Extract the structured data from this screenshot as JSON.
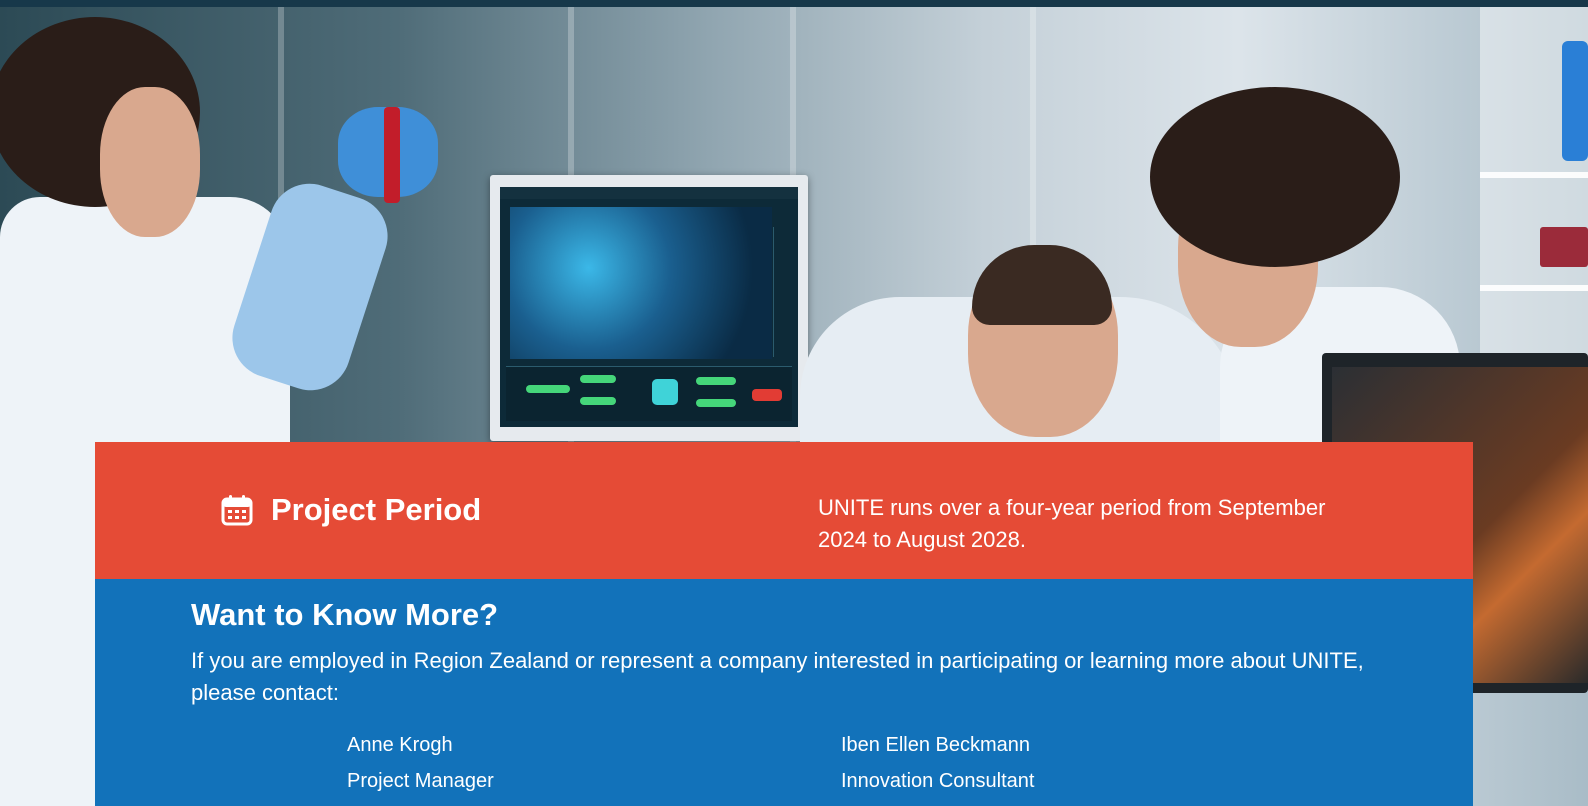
{
  "hero": {
    "image_description_icon": "laboratory-photo"
  },
  "period": {
    "icon": "calendar-icon",
    "heading": "Project Period",
    "text": "UNITE runs over a four-year period from September 2024 to August 2028."
  },
  "contact": {
    "heading": "Want to Know More?",
    "text": "If you are employed in Region Zealand or represent a company interested in participating or learning more about UNITE, please contact:",
    "people": [
      {
        "name": "Anne Krogh",
        "role": "Project Manager"
      },
      {
        "name": "Iben Ellen Beckmann",
        "role": "Innovation Consultant"
      }
    ]
  },
  "colors": {
    "period_band": "#e54b36",
    "contact_band": "#1272ba",
    "top_bar": "#17384a"
  }
}
